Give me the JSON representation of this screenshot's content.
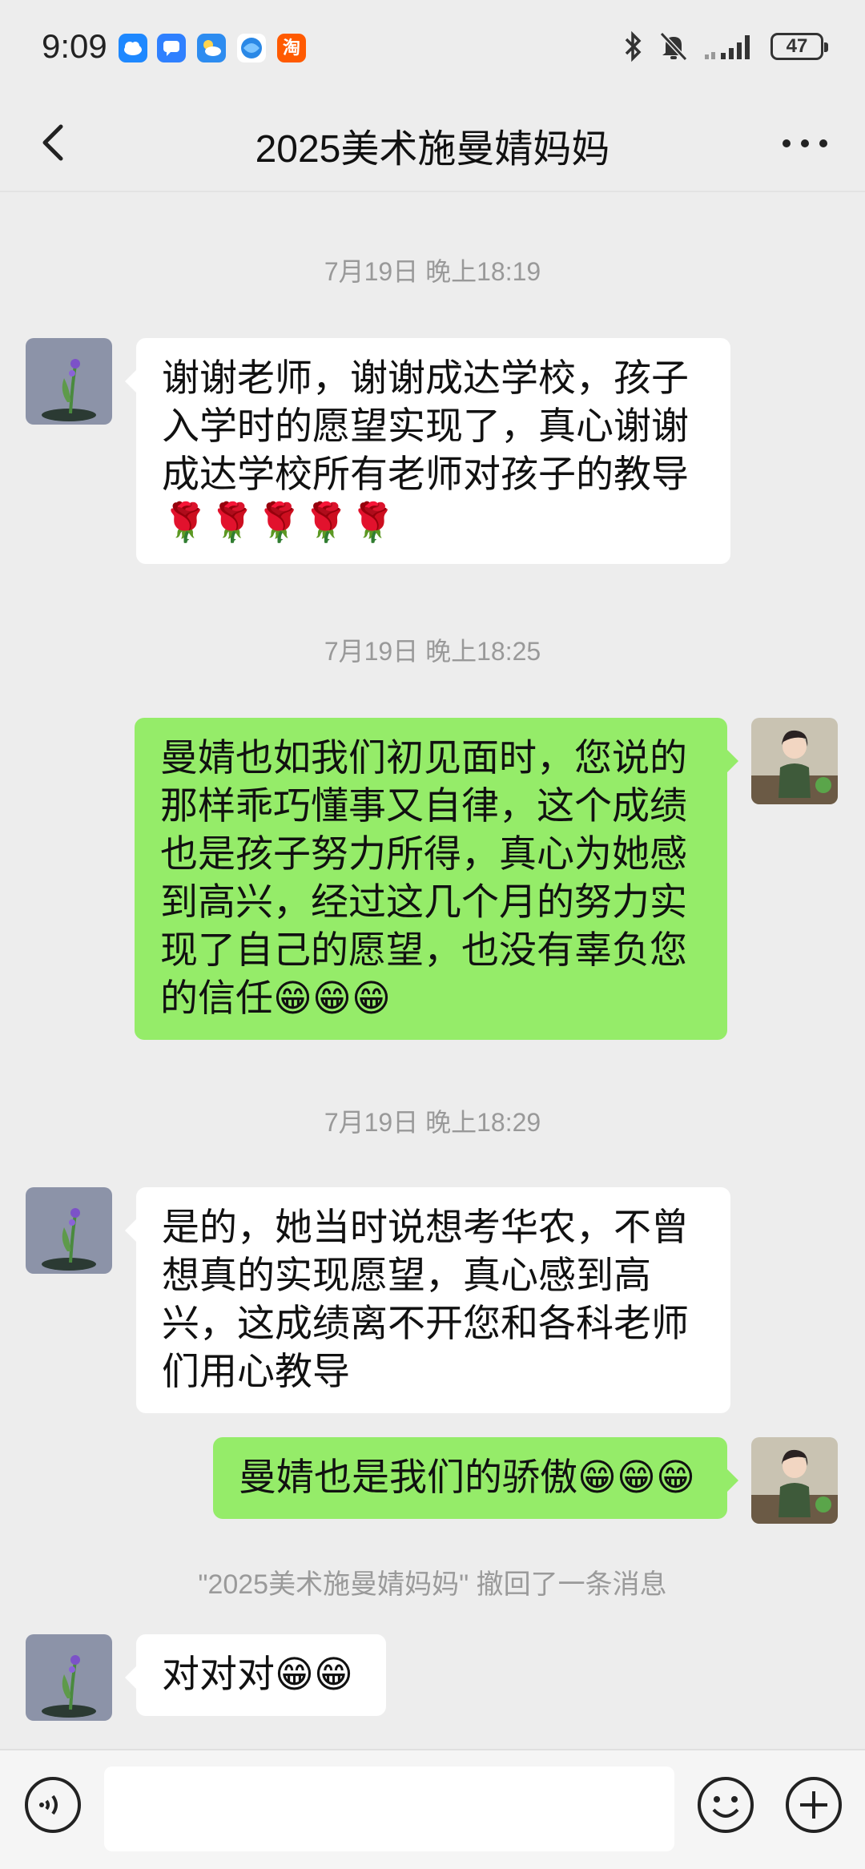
{
  "status_bar": {
    "time": "9:09",
    "battery": "47",
    "notification_icons": [
      "cloud-app-icon",
      "message-app-icon",
      "weather-app-icon",
      "browser-app-icon",
      "taobao-app-icon"
    ],
    "taobao_label": "淘"
  },
  "header": {
    "title": "2025美术施曼婧妈妈",
    "back_icon": "back-arrow-icon",
    "more_icon": "more-dots-icon"
  },
  "messages": [
    {
      "type": "timestamp",
      "text": "7月19日 晚上18:19"
    },
    {
      "type": "incoming",
      "text": "谢谢老师，谢谢成达学校，孩子入学时的愿望实现了，真心谢谢成达学校所有老师对孩子的教导🌹🌹🌹🌹🌹"
    },
    {
      "type": "timestamp",
      "text": "7月19日 晚上18:25"
    },
    {
      "type": "outgoing",
      "text": "曼婧也如我们初见面时，您说的那样乖巧懂事又自律，这个成绩也是孩子努力所得，真心为她感到高兴，经过这几个月的努力实现了自己的愿望，也没有辜负您的信任😁😁😁"
    },
    {
      "type": "timestamp",
      "text": "7月19日 晚上18:29"
    },
    {
      "type": "incoming",
      "text": "是的，她当时说想考华农，不曾想真的实现愿望，真心感到高兴，这成绩离不开您和各科老师们用心教导"
    },
    {
      "type": "outgoing",
      "text": "曼婧也是我们的骄傲😁😁😁"
    },
    {
      "type": "system",
      "text": "\"2025美术施曼婧妈妈\" 撤回了一条消息"
    },
    {
      "type": "incoming",
      "text": "对对对😁😁"
    }
  ],
  "input_bar": {
    "voice_icon": "voice-icon",
    "emoji_icon": "emoji-icon",
    "plus_icon": "plus-icon",
    "input_value": ""
  },
  "colors": {
    "background": "#ededed",
    "outgoing_bubble": "#95ec69",
    "incoming_bubble": "#ffffff",
    "timestamp_text": "#999999"
  }
}
